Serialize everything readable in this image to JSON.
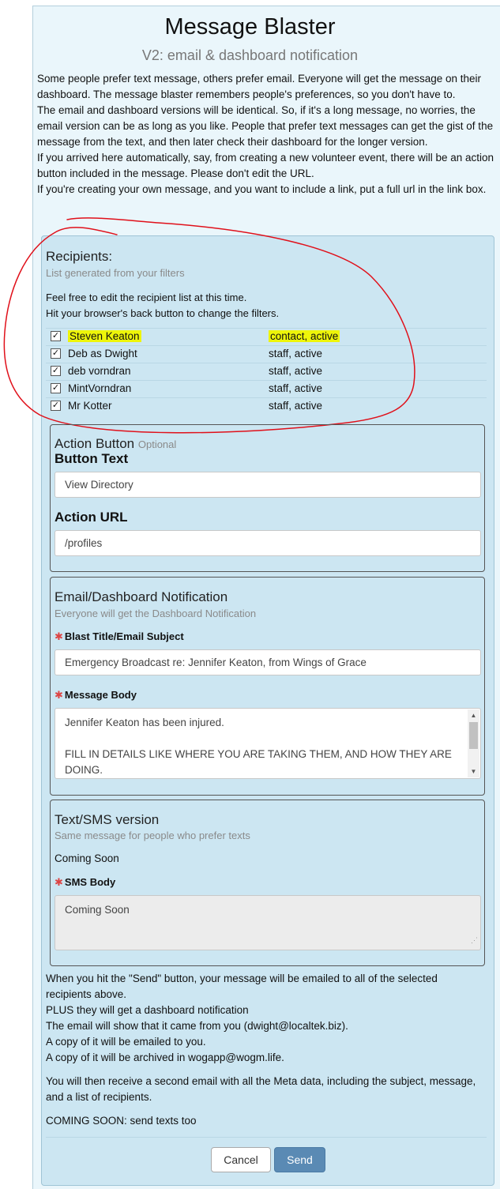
{
  "header": {
    "title": "Message Blaster",
    "subtitle": "V2: email & dashboard notification"
  },
  "intro": {
    "p1": "Some people prefer text message, others prefer email. Everyone will get the message on their dashboard. The message blaster remembers people's preferences, so you don't have to.",
    "p2": "The email and dashboard versions will be identical. So, if it's a long message, no worries, the email version can be as long as you like. People that prefer text messages can get the gist of the message from the text, and then later check their dashboard for the longer version.",
    "p3": "If you arrived here automatically, say, from creating a new volunteer event, there will be an action button included in the message. Please don't edit the URL.",
    "p4": "If you're creating your own message, and you want to include a link, put a full url in the link box."
  },
  "recipients": {
    "heading": "Recipients:",
    "subheading": "List generated from your filters",
    "note1": "Feel free to edit the recipient list at this time.",
    "note2": "Hit your browser's back button to change the filters.",
    "rows": [
      {
        "name": "Steven Keaton",
        "status": "contact, active",
        "checked": true,
        "highlighted": true
      },
      {
        "name": "Deb as Dwight",
        "status": "staff, active",
        "checked": true
      },
      {
        "name": "deb vorndran",
        "status": "staff, active",
        "checked": true
      },
      {
        "name": "MintVorndran",
        "status": "staff, active",
        "checked": true
      },
      {
        "name": "Mr Kotter",
        "status": "staff, active",
        "checked": true
      }
    ],
    "check_glyph": "✓"
  },
  "action_button": {
    "title": "Action Button",
    "optional": "Optional",
    "button_text_label": "Button Text",
    "button_text_value": "View Directory",
    "action_url_label": "Action URL",
    "action_url_value": "/profiles"
  },
  "email": {
    "title": "Email/Dashboard Notification",
    "subtitle": "Everyone will get the Dashboard Notification",
    "subject_label": "Blast Title/Email Subject",
    "subject_value": "Emergency Broadcast re: Jennifer Keaton, from Wings of Grace",
    "body_label": "Message Body",
    "body_line1": "Jennifer Keaton has been injured.",
    "body_line2": "FILL IN DETAILS LIKE WHERE YOU ARE TAKING THEM, AND HOW THEY ARE DOING.",
    "required_mark": "✱"
  },
  "sms": {
    "title": "Text/SMS version",
    "subtitle": "Same message for people who prefer texts",
    "coming_soon": "Coming Soon",
    "body_label": "SMS Body",
    "body_value": "Coming Soon"
  },
  "footer": {
    "l1": "When you hit the \"Send\" button, your message will be emailed to all of the selected recipients above.",
    "l2": "PLUS they will get a dashboard notification",
    "l3": "The email will show that it came from you (dwight@localtek.biz).",
    "l4": "A copy of it will be emailed to you.",
    "l5": "A copy of it will be archived in wogapp@wogm.life.",
    "l6": "You will then receive a second email with all the Meta data, including the subject, message, and a list of recipients.",
    "l7": "COMING SOON: send texts too"
  },
  "buttons": {
    "cancel": "Cancel",
    "send": "Send"
  },
  "colors": {
    "highlight": "#eef50a",
    "annotation": "#e0101a",
    "send_button": "#5a8ab4"
  }
}
